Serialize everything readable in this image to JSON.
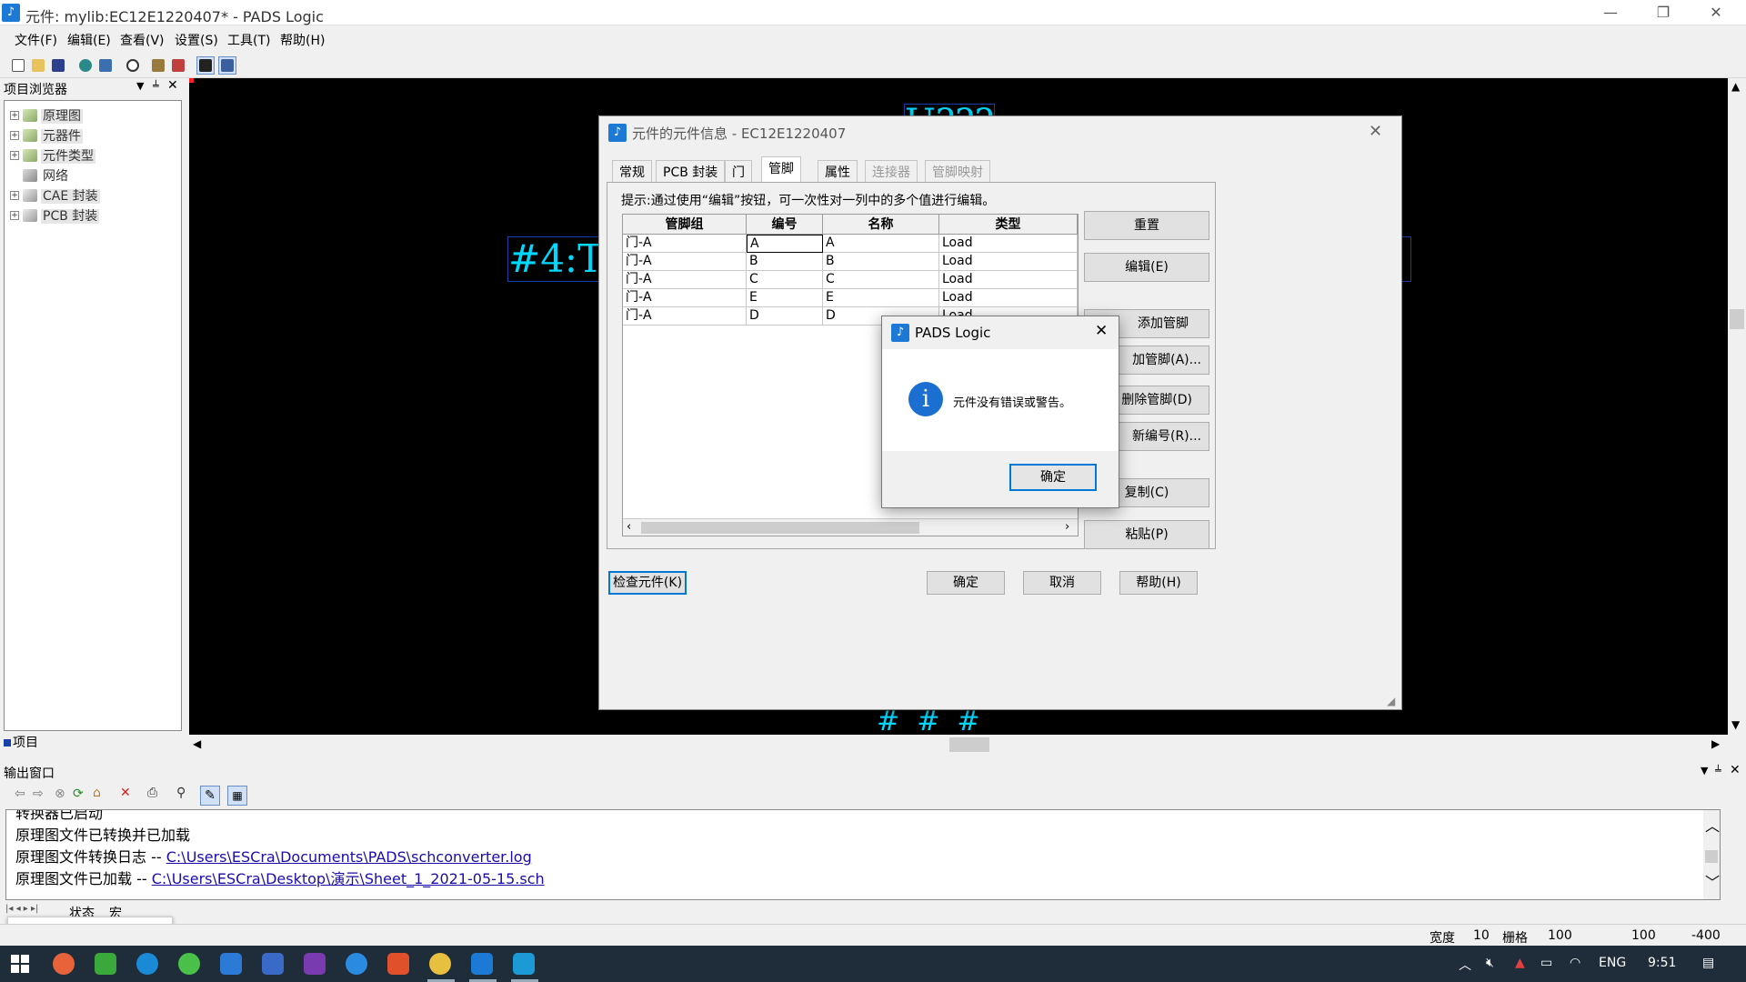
{
  "window": {
    "title": "元件: mylib:EC12E1220407* - PADS Logic",
    "app_icon": "pads-logo-icon",
    "controls": [
      "minimize",
      "restore",
      "close"
    ]
  },
  "menu": [
    "文件(F)",
    "编辑(E)",
    "查看(V)",
    "设置(S)",
    "工具(T)",
    "帮助(H)"
  ],
  "project_browser": {
    "title": "项目浏览器",
    "items": [
      {
        "label": "原理图",
        "expandable": true
      },
      {
        "label": "元器件",
        "expandable": true
      },
      {
        "label": "元件类型",
        "expandable": true
      },
      {
        "label": "网络",
        "expandable": false
      },
      {
        "label": "CAE 封装",
        "expandable": true
      },
      {
        "label": "PCB 封装",
        "expandable": true
      }
    ],
    "tab_label": "项目"
  },
  "canvas": {
    "text_top": "U???",
    "text_left": "#4:TY",
    "text_bottom": "#  #  #",
    "accent": "#00d8ff"
  },
  "part_dialog": {
    "title": "元件的元件信息 - EC12E1220407",
    "tabs": [
      {
        "label": "常规",
        "state": "normal"
      },
      {
        "label": "PCB 封装",
        "state": "normal"
      },
      {
        "label": "门",
        "state": "normal"
      },
      {
        "label": "管脚",
        "state": "active"
      },
      {
        "label": "属性",
        "state": "normal"
      },
      {
        "label": "连接器",
        "state": "disabled"
      },
      {
        "label": "管脚映射",
        "state": "disabled"
      }
    ],
    "hint": "提示:通过使用“编辑”按钮，可一次性对一列中的多个值进行编辑。",
    "columns": [
      "管脚组",
      "编号",
      "名称",
      "类型"
    ],
    "rows": [
      [
        "门-A",
        "A",
        "A",
        "Load"
      ],
      [
        "门-A",
        "B",
        "B",
        "Load"
      ],
      [
        "门-A",
        "C",
        "C",
        "Load"
      ],
      [
        "门-A",
        "E",
        "E",
        "Load"
      ],
      [
        "门-A",
        "D",
        "D",
        "Load"
      ]
    ],
    "side_buttons": [
      "重置",
      "编辑(E)",
      "添加管脚",
      "加管脚(A)...",
      "删除管脚(D)",
      "新编号(R)...",
      "复制(C)",
      "粘贴(P)"
    ],
    "bottom_buttons": {
      "check": "检查元件(K)",
      "ok": "确定",
      "cancel": "取消",
      "help": "帮助(H)"
    }
  },
  "message_box": {
    "title": "PADS Logic",
    "message": "元件没有错误或警告。",
    "icon": "info-icon",
    "ok": "确定"
  },
  "output_window": {
    "title": "输出窗口",
    "line_partial": "转换器已启动",
    "line1": "原理图文件已转换并已加载",
    "line2_prefix": "原理图文件转换日志 -- ",
    "line2_link": "C:\\Users\\ESCra\\Documents\\PADS\\schconverter.log",
    "line3_prefix": "原理图文件已加载 -- ",
    "line3_link": "C:\\Users\\ESCra\\Desktop\\演示\\Sheet_1_2021-05-15.sch",
    "tabs": [
      "状态",
      "宏"
    ]
  },
  "status_bar": {
    "width_label": "宽度",
    "width_value": "10",
    "grid_label": "栅格",
    "grid_value": "100",
    "x": "100",
    "y": "-400"
  },
  "taskbar": {
    "lang": "ENG",
    "time": "9:51"
  },
  "colors": {
    "canvas_bg": "#000000",
    "canvas_text": "#00d8ff",
    "selection_blue": "#0078d7",
    "link": "#1a0dab"
  }
}
